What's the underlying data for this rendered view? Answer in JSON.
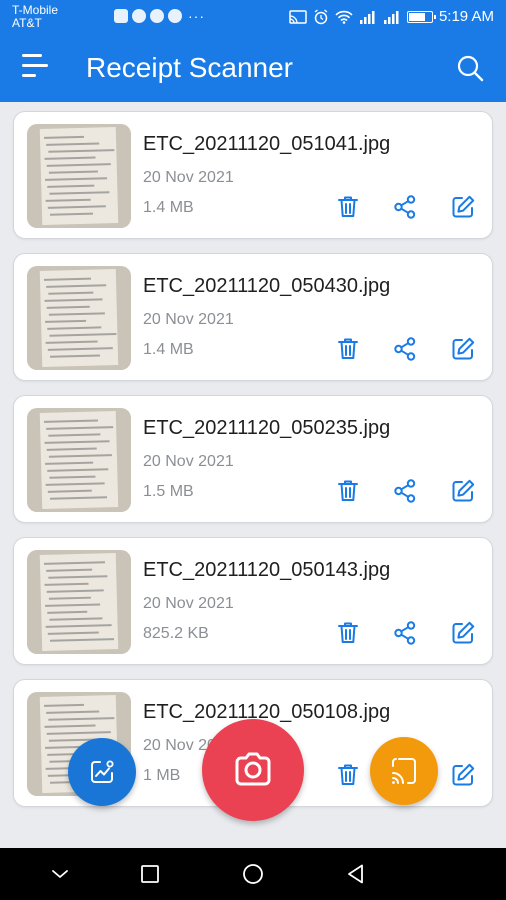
{
  "status_bar": {
    "carrier_line1": "T-Mobile",
    "carrier_line2": "AT&T",
    "time": "5:19 AM",
    "notification_icons": [
      "youtube-icon",
      "skype-icon",
      "messenger-icon",
      "whatsapp-icon"
    ],
    "overflow": "···",
    "battery_level": 0.78
  },
  "app_bar": {
    "title": "Receipt Scanner"
  },
  "receipts": [
    {
      "name": "ETC_20211120_051041.jpg",
      "date": "20 Nov 2021",
      "size": "1.4 MB"
    },
    {
      "name": "ETC_20211120_050430.jpg",
      "date": "20 Nov 2021",
      "size": "1.4 MB"
    },
    {
      "name": "ETC_20211120_050235.jpg",
      "date": "20 Nov 2021",
      "size": "1.5 MB"
    },
    {
      "name": "ETC_20211120_050143.jpg",
      "date": "20 Nov 2021",
      "size": "825.2 KB"
    },
    {
      "name": "ETC_20211120_050108.jpg",
      "date": "20 Nov 2021",
      "size": "1 MB"
    }
  ],
  "colors": {
    "primary": "#1a7be6",
    "camera_fab": "#ea4253",
    "import_fab": "#f39a0c",
    "analytics_fab": "#1976d6",
    "action_icon": "#1a7be6"
  }
}
